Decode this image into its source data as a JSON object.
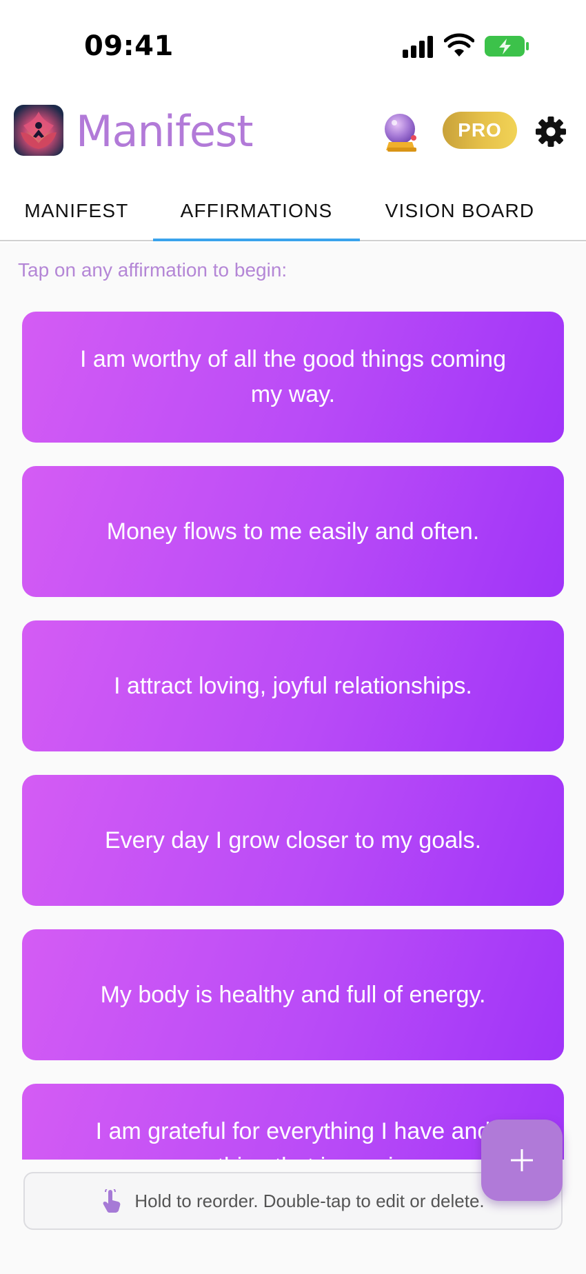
{
  "status_bar": {
    "time": "09:41"
  },
  "header": {
    "title": "Manifest",
    "pro_label": "PRO"
  },
  "tabs": [
    {
      "label": "MANIFEST"
    },
    {
      "label": "AFFIRMATIONS",
      "active": true
    },
    {
      "label": "VISION BOARD"
    }
  ],
  "content": {
    "hint": "Tap on any affirmation to begin:",
    "affirmations": [
      "I am worthy of all the good things coming my way.",
      "Money flows to me easily and often.",
      "I attract loving, joyful relationships.",
      "Every day I grow closer to my goals.",
      "My body is healthy and full of energy.",
      "I am grateful for everything I have and everything that is coming."
    ]
  },
  "footer": {
    "reorder_hint": "Hold to reorder. Double-tap to edit or delete."
  },
  "icons": [
    "signal-icon",
    "wifi-icon",
    "battery-icon",
    "app-logo",
    "crystal-ball-icon",
    "gear-icon",
    "hand-icon",
    "plus-icon"
  ],
  "colors": {
    "brand_title": "#b27ad8",
    "tab_indicator": "#3aa3ec",
    "card_gradient_start": "#d45cf4",
    "card_gradient_end": "#9f34f8",
    "pro_badge": "#e6c14a",
    "fab": "#b07ad8"
  }
}
